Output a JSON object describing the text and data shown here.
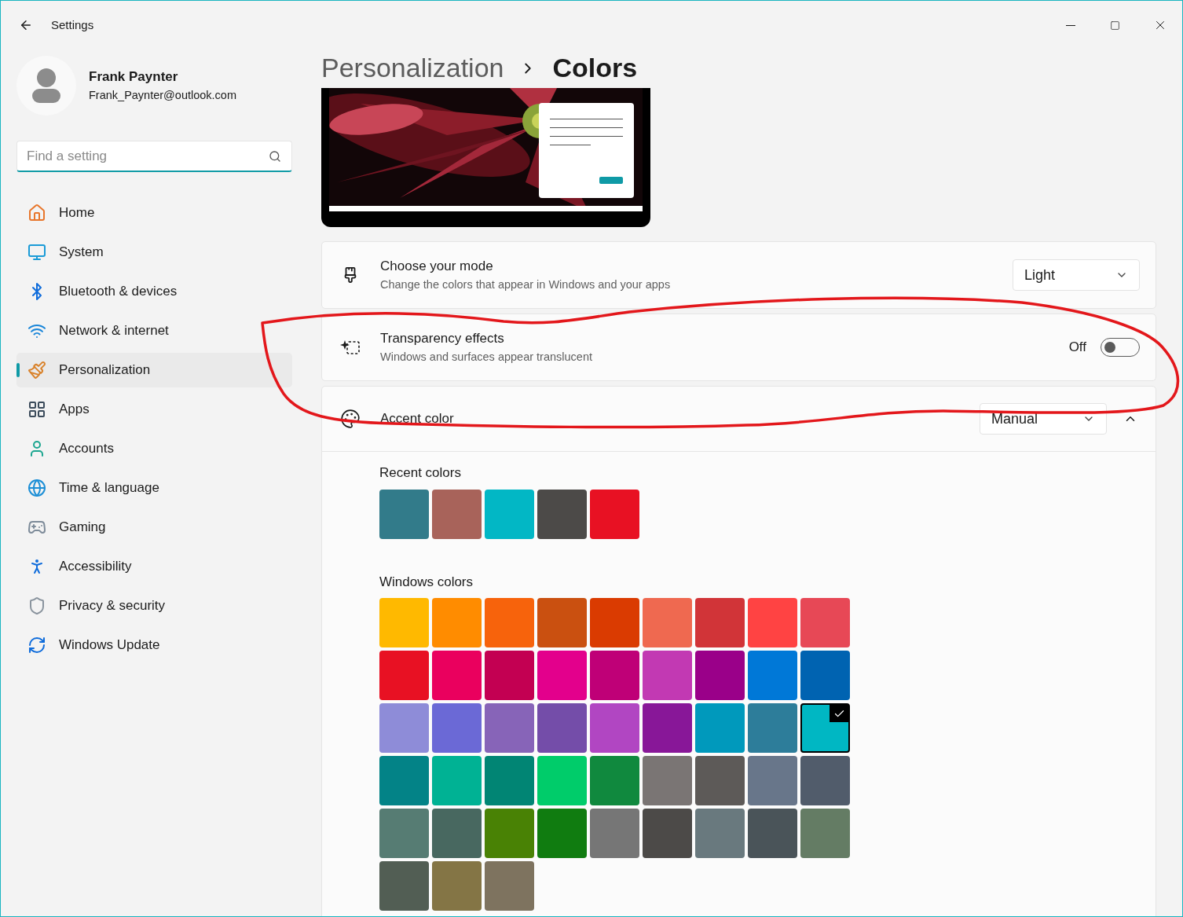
{
  "window": {
    "title": "Settings"
  },
  "user": {
    "name": "Frank Paynter",
    "email": "Frank_Paynter@outlook.com"
  },
  "search": {
    "placeholder": "Find a setting"
  },
  "sidebar": {
    "items": [
      {
        "label": "Home",
        "selected": false
      },
      {
        "label": "System",
        "selected": false
      },
      {
        "label": "Bluetooth & devices",
        "selected": false
      },
      {
        "label": "Network & internet",
        "selected": false
      },
      {
        "label": "Personalization",
        "selected": true
      },
      {
        "label": "Apps",
        "selected": false
      },
      {
        "label": "Accounts",
        "selected": false
      },
      {
        "label": "Time & language",
        "selected": false
      },
      {
        "label": "Gaming",
        "selected": false
      },
      {
        "label": "Accessibility",
        "selected": false
      },
      {
        "label": "Privacy & security",
        "selected": false
      },
      {
        "label": "Windows Update",
        "selected": false
      }
    ]
  },
  "breadcrumb": [
    "Personalization",
    "Colors"
  ],
  "settings": [
    {
      "kind": "dropdown",
      "title": "Choose your mode",
      "description": "Change the colors that appear in Windows and your apps",
      "value": "Light"
    },
    {
      "kind": "toggle",
      "title": "Transparency effects",
      "description": "Windows and surfaces appear translucent",
      "state_label": "Off",
      "on": false
    },
    {
      "kind": "expander",
      "title": "Accent color",
      "value": "Manual",
      "expanded": true
    }
  ],
  "recent_colors": {
    "title": "Recent colors",
    "colors": [
      {
        "color": "#327b8a",
        "selected": false
      },
      {
        "color": "#a8635a",
        "selected": false
      },
      {
        "color": "#02b7c5",
        "selected": false
      },
      {
        "color": "#4c4a48",
        "selected": false
      },
      {
        "color": "#e81123",
        "selected": false
      }
    ]
  },
  "windows_colors": {
    "title": "Windows colors",
    "colors": [
      {
        "color": "#ffb900",
        "selected": false
      },
      {
        "color": "#ff8c00",
        "selected": false
      },
      {
        "color": "#f7630c",
        "selected": false
      },
      {
        "color": "#ca5010",
        "selected": false
      },
      {
        "color": "#da3b01",
        "selected": false
      },
      {
        "color": "#ef6950",
        "selected": false
      },
      {
        "color": "#d13438",
        "selected": false
      },
      {
        "color": "#ff4343",
        "selected": false
      },
      {
        "color": "#e74856",
        "selected": false
      },
      {
        "color": "#e81123",
        "selected": false
      },
      {
        "color": "#ea005e",
        "selected": false
      },
      {
        "color": "#c30052",
        "selected": false
      },
      {
        "color": "#e3008c",
        "selected": false
      },
      {
        "color": "#bf0077",
        "selected": false
      },
      {
        "color": "#c239b3",
        "selected": false
      },
      {
        "color": "#9a0089",
        "selected": false
      },
      {
        "color": "#0078d7",
        "selected": false
      },
      {
        "color": "#0063b1",
        "selected": false
      },
      {
        "color": "#8e8cd8",
        "selected": false
      },
      {
        "color": "#6b69d6",
        "selected": false
      },
      {
        "color": "#8764b8",
        "selected": false
      },
      {
        "color": "#744da9",
        "selected": false
      },
      {
        "color": "#b146c2",
        "selected": false
      },
      {
        "color": "#881798",
        "selected": false
      },
      {
        "color": "#0099bc",
        "selected": false
      },
      {
        "color": "#2d7d9a",
        "selected": false
      },
      {
        "color": "#00b7c3",
        "selected": true
      },
      {
        "color": "#038387",
        "selected": false
      },
      {
        "color": "#00b294",
        "selected": false
      },
      {
        "color": "#018574",
        "selected": false
      },
      {
        "color": "#00cc6a",
        "selected": false
      },
      {
        "color": "#10893e",
        "selected": false
      },
      {
        "color": "#7a7574",
        "selected": false
      },
      {
        "color": "#5d5a58",
        "selected": false
      },
      {
        "color": "#68768a",
        "selected": false
      },
      {
        "color": "#515c6b",
        "selected": false
      },
      {
        "color": "#567c73",
        "selected": false
      },
      {
        "color": "#486860",
        "selected": false
      },
      {
        "color": "#498205",
        "selected": false
      },
      {
        "color": "#107c10",
        "selected": false
      },
      {
        "color": "#767676",
        "selected": false
      },
      {
        "color": "#4c4a48",
        "selected": false
      },
      {
        "color": "#69797e",
        "selected": false
      },
      {
        "color": "#4a5459",
        "selected": false
      },
      {
        "color": "#647c64",
        "selected": false
      },
      {
        "color": "#525e54",
        "selected": false
      },
      {
        "color": "#847545",
        "selected": false
      },
      {
        "color": "#7e735f",
        "selected": false
      }
    ]
  }
}
